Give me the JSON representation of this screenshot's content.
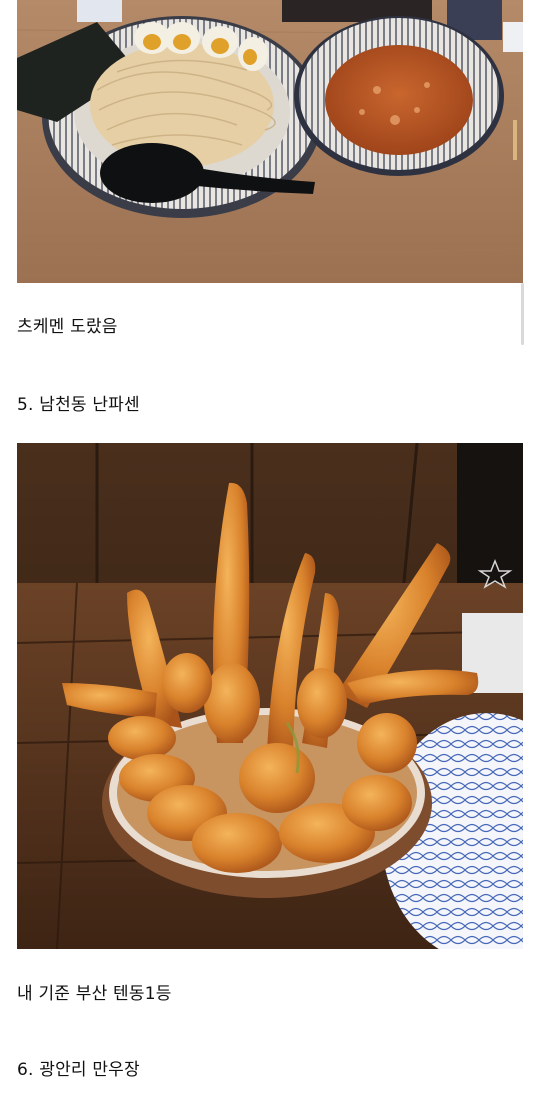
{
  "posts": [
    {
      "caption": "츠케멘 도랐음"
    },
    {
      "heading": "5. 남천동 난파센",
      "caption": "내 기준 부산 텐동1등"
    },
    {
      "heading": "6. 광안리 만우장"
    }
  ],
  "images": [
    {
      "subject": "tsukemen",
      "icon": "photo-icon"
    },
    {
      "subject": "tendon",
      "icon": "photo-icon"
    }
  ],
  "colors": {
    "text": "#111111",
    "background": "#ffffff",
    "scrollbar": "#d9d9d9"
  }
}
